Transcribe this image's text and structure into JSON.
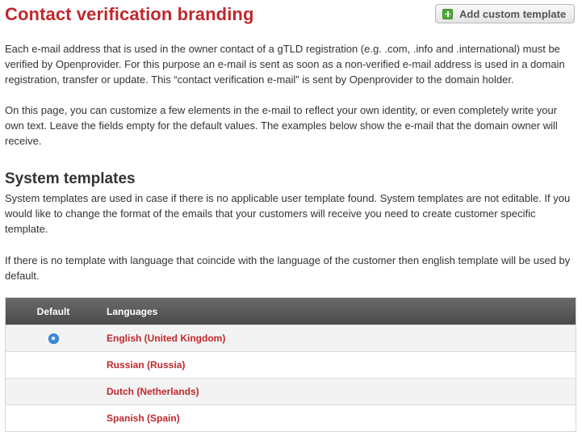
{
  "header": {
    "title": "Contact verification branding",
    "add_button_label": "Add custom template",
    "add_button_icon": "plus-icon"
  },
  "intro": {
    "paragraph1": "Each e-mail address that is used in the owner contact of a gTLD registration (e.g. .com, .info and .international) must be verified by Openprovider. For this purpose an e-mail is sent as soon as a non-verified e-mail address is used in a domain registration, transfer or update. This “contact verification e-mail” is sent by Openprovider to the domain holder.",
    "paragraph2": "On this page, you can customize a few elements in the e-mail to reflect your own identity, or even completely write your own text. Leave the fields empty for the default values. The examples below show the e-mail that the domain owner will receive."
  },
  "system_templates": {
    "title": "System templates",
    "paragraph1": "System templates are used in case if there is no applicable user template found. System templates are not editable. If you would like to change the format of the emails that your customers will receive you need to create customer specific template.",
    "paragraph2": "If there is no template with language that coincide with the language of the customer then english template will be used by default.",
    "table": {
      "columns": [
        "Default",
        "Languages"
      ],
      "rows": [
        {
          "default": true,
          "language": "English (United Kingdom)"
        },
        {
          "default": false,
          "language": "Russian (Russia)"
        },
        {
          "default": false,
          "language": "Dutch (Netherlands)"
        },
        {
          "default": false,
          "language": "Spanish (Spain)"
        }
      ]
    }
  },
  "colors": {
    "accent": "#c0282d",
    "header_bg": "#4a4a4a",
    "radio": "#3b8ddd",
    "plus": "#4fa93b"
  }
}
